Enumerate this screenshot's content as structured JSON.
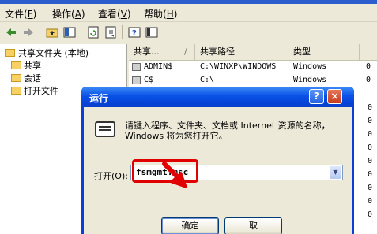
{
  "menubar": {
    "items": [
      {
        "label": "文件",
        "key": "F"
      },
      {
        "label": "操作",
        "key": "A"
      },
      {
        "label": "查看",
        "key": "V"
      },
      {
        "label": "帮助",
        "key": "H"
      }
    ]
  },
  "tree": {
    "root": "共享文件夹 (本地)",
    "children": [
      "共享",
      "会话",
      "打开文件"
    ]
  },
  "list": {
    "columns": [
      "共享...",
      "共享路径",
      "类型"
    ],
    "rows": [
      {
        "name": "ADMIN$",
        "path": "C:\\WINXP\\WINDOWS",
        "type": "Windows",
        "extra": "0"
      },
      {
        "name": "C$",
        "path": "C:\\",
        "type": "Windows",
        "extra": "0"
      }
    ],
    "right_edge": [
      "0",
      "0",
      "0",
      "0",
      "0",
      "0",
      "0",
      "0",
      "0"
    ]
  },
  "dialog": {
    "title": "运行",
    "help_glyph": "?",
    "close_glyph": "×",
    "description": "请键入程序、文件夹、文档或 Internet 资源的名称，Windows 将为您打开它。",
    "open_label": "打开(O):",
    "open_value": "fsmgmt.msc",
    "ok_label": "确定",
    "cancel_label": "取"
  },
  "colors": {
    "titlebar": "#0a52e8",
    "highlight": "#e00000"
  }
}
